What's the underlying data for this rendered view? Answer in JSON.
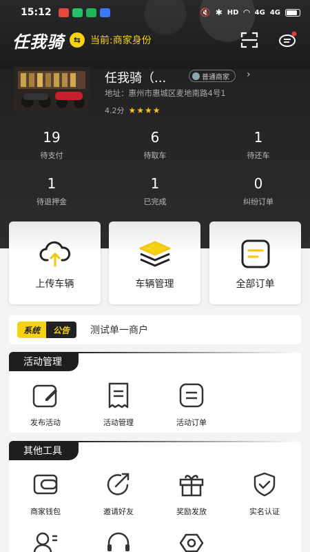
{
  "status_bar": {
    "time": "15:12",
    "right_labels": [
      "HD",
      "4G",
      "4G"
    ],
    "app_icon_colors": [
      "#e8473d",
      "#27c16a",
      "#1fb65a",
      "#3a78f5"
    ]
  },
  "header": {
    "brand": "任我骑",
    "role_label": "当前:商家身份",
    "icons": [
      "swap-icon",
      "scan-icon",
      "message-icon"
    ]
  },
  "shop": {
    "name": "任我骑（...",
    "badge": "普通商家",
    "address": "地址：惠州市惠城区麦地南路4号1",
    "rating": "4.2分",
    "stars": "★★★★"
  },
  "stats": [
    {
      "value": "19",
      "label": "待支付"
    },
    {
      "value": "6",
      "label": "待取车"
    },
    {
      "value": "1",
      "label": "待还车"
    },
    {
      "value": "1",
      "label": "待退押金"
    },
    {
      "value": "1",
      "label": "已完成"
    },
    {
      "value": "0",
      "label": "纠纷订单"
    }
  ],
  "quick_cards": [
    {
      "label": "上传车辆",
      "icon": "cloud-upload-icon"
    },
    {
      "label": "车辆管理",
      "icon": "layers-icon"
    },
    {
      "label": "全部订单",
      "icon": "order-list-icon"
    }
  ],
  "notice": {
    "tag_a": "系统",
    "tag_b": "公告",
    "text": "测试单一商户"
  },
  "activity": {
    "title": "活动管理",
    "items": [
      {
        "label": "发布活动",
        "icon": "edit-icon"
      },
      {
        "label": "活动管理",
        "icon": "receipt-icon"
      },
      {
        "label": "活动订单",
        "icon": "document-icon"
      }
    ]
  },
  "tools": {
    "title": "其他工具",
    "items": [
      {
        "label": "商家钱包",
        "icon": "wallet-icon"
      },
      {
        "label": "邀请好友",
        "icon": "share-icon"
      },
      {
        "label": "奖励发放",
        "icon": "gift-icon"
      },
      {
        "label": "实名认证",
        "icon": "shield-check-icon"
      }
    ],
    "partial_icons": [
      "contacts-icon",
      "headset-icon",
      "settings-icon"
    ]
  },
  "colors": {
    "accent_yellow": "#f5d312",
    "dark": "#1e1e1e",
    "star": "#f5c518"
  }
}
